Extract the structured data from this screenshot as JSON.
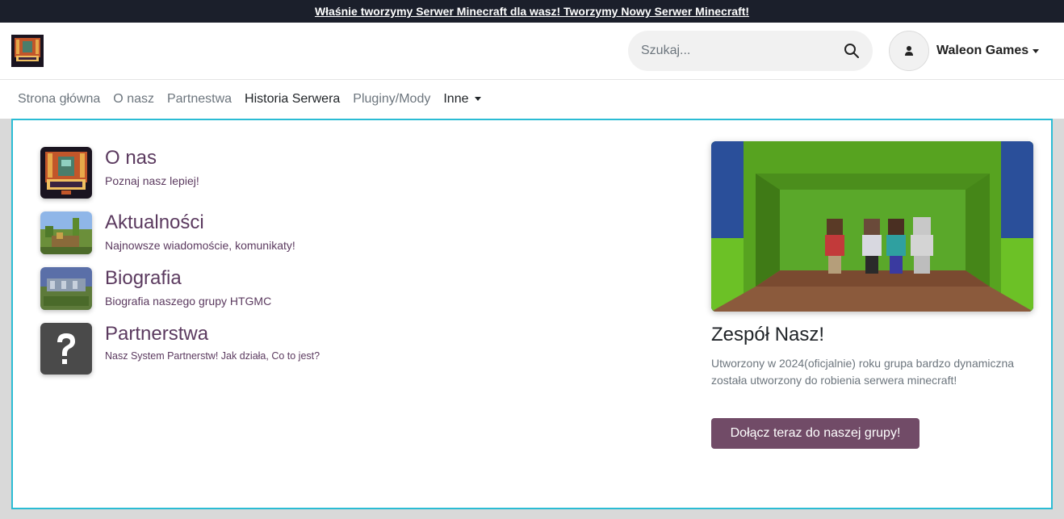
{
  "announcement": {
    "text": "Właśnie tworzymy Serwer Minecraft dla wasz! Tworzymy Nowy Serwer Minecraft!"
  },
  "header": {
    "logo_icon": "htgmc-logo",
    "search": {
      "placeholder": "Szukaj...",
      "value": "",
      "icon": "search-icon"
    },
    "user": {
      "name": "Waleon Games",
      "icon": "user-icon"
    }
  },
  "nav": {
    "items": [
      {
        "label": "Strona główna"
      },
      {
        "label": "O nasz"
      },
      {
        "label": "Partnestwa"
      },
      {
        "label": "Historia Serwera",
        "active": true
      },
      {
        "label": "Pluginy/Mody"
      },
      {
        "label": "Inne"
      }
    ]
  },
  "menu": {
    "entries": [
      {
        "title": "O nas",
        "subtitle": "Poznaj nasz lepiej!",
        "thumb": "htgmc-logo"
      },
      {
        "title": "Aktualności",
        "subtitle": "Najnowsze wiadomoście, komunikaty!",
        "thumb": "minecraft-landscape"
      },
      {
        "title": "Biografia",
        "subtitle": "Biografia naszego grupy HTGMC",
        "thumb": "minecraft-htg-build"
      },
      {
        "title": "Partnerstwa",
        "subtitle": "Nasz System Partnerstw! Jak działa, Co to jest?",
        "thumb": "question-mark"
      }
    ],
    "feature": {
      "title": "Zespół Nasz!",
      "description": "Utworzony w 2024(oficjalnie) roku grupa bardzo dynamiczna została utworzony do robienia serwera minecraft!",
      "button": "Dołącz teraz do naszej grupy!",
      "image": "minecraft-team-photo"
    }
  },
  "colors": {
    "accent": "#714b67",
    "panel_border": "#2bbcd4",
    "topbar": "#1b1f2b"
  }
}
